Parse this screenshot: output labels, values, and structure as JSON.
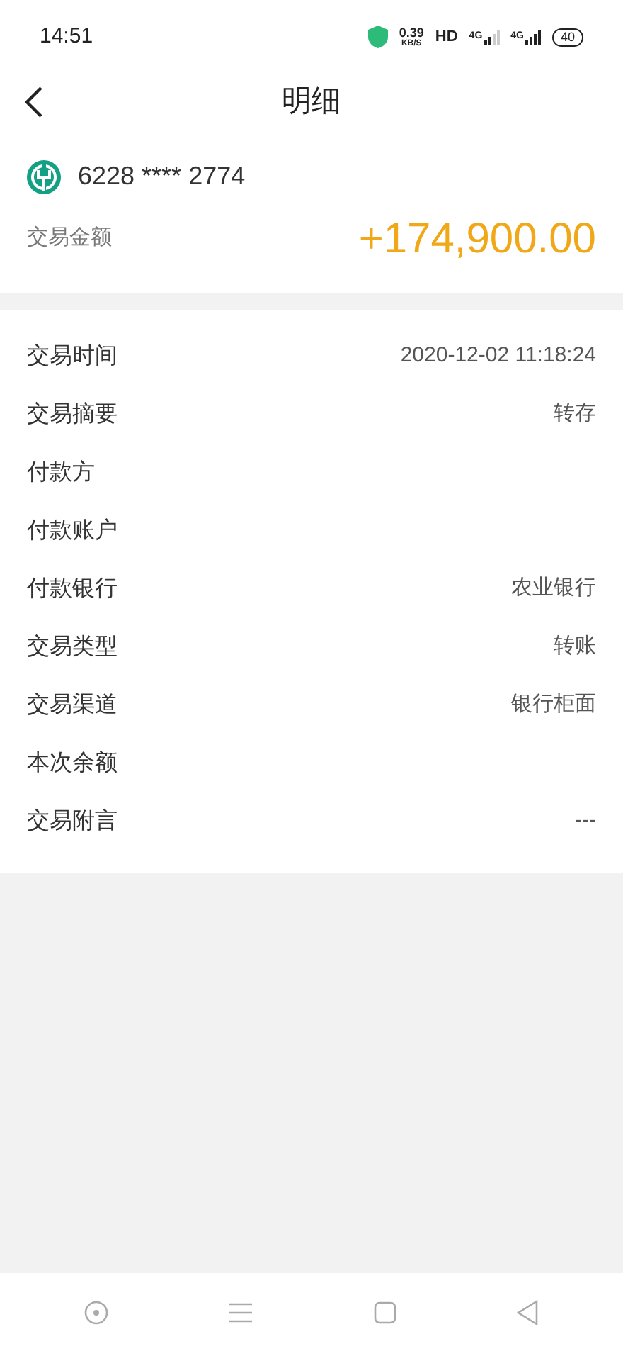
{
  "status_bar": {
    "time": "14:51",
    "speed_value": "0.39",
    "speed_unit": "KB/S",
    "hd": "HD",
    "networks": [
      {
        "label": "4G"
      },
      {
        "label": "4G"
      }
    ],
    "battery": "40"
  },
  "header": {
    "title": "明细"
  },
  "account": {
    "card_number": "6228 **** 2774",
    "amount_label": "交易金额",
    "amount": "+174,900.00"
  },
  "details": [
    {
      "label": "交易时间",
      "value": "2020-12-02 11:18:24"
    },
    {
      "label": "交易摘要",
      "value": "转存"
    },
    {
      "label": "付款方"
    },
    {
      "label": "付款账户"
    },
    {
      "label": "付款银行",
      "value": "农业银行"
    },
    {
      "label": "交易类型",
      "value": "转账"
    },
    {
      "label": "交易渠道",
      "value": "银行柜面"
    },
    {
      "label": "本次余额"
    },
    {
      "label": "交易附言",
      "value": "---"
    }
  ]
}
